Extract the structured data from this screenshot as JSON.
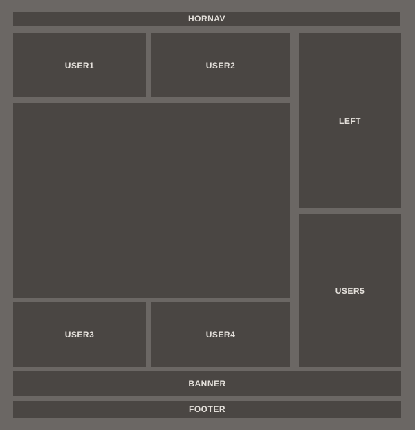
{
  "layout": {
    "hornav": "HORNAV",
    "user1": "USER1",
    "user2": "USER2",
    "left": "LEFT",
    "main": "",
    "user5": "USER5",
    "user3": "USER3",
    "user4": "USER4",
    "banner": "BANNER",
    "footer": "FOOTER"
  },
  "colors": {
    "background": "#6b6764",
    "block": "#4a4643",
    "text": "#e4e0db"
  }
}
